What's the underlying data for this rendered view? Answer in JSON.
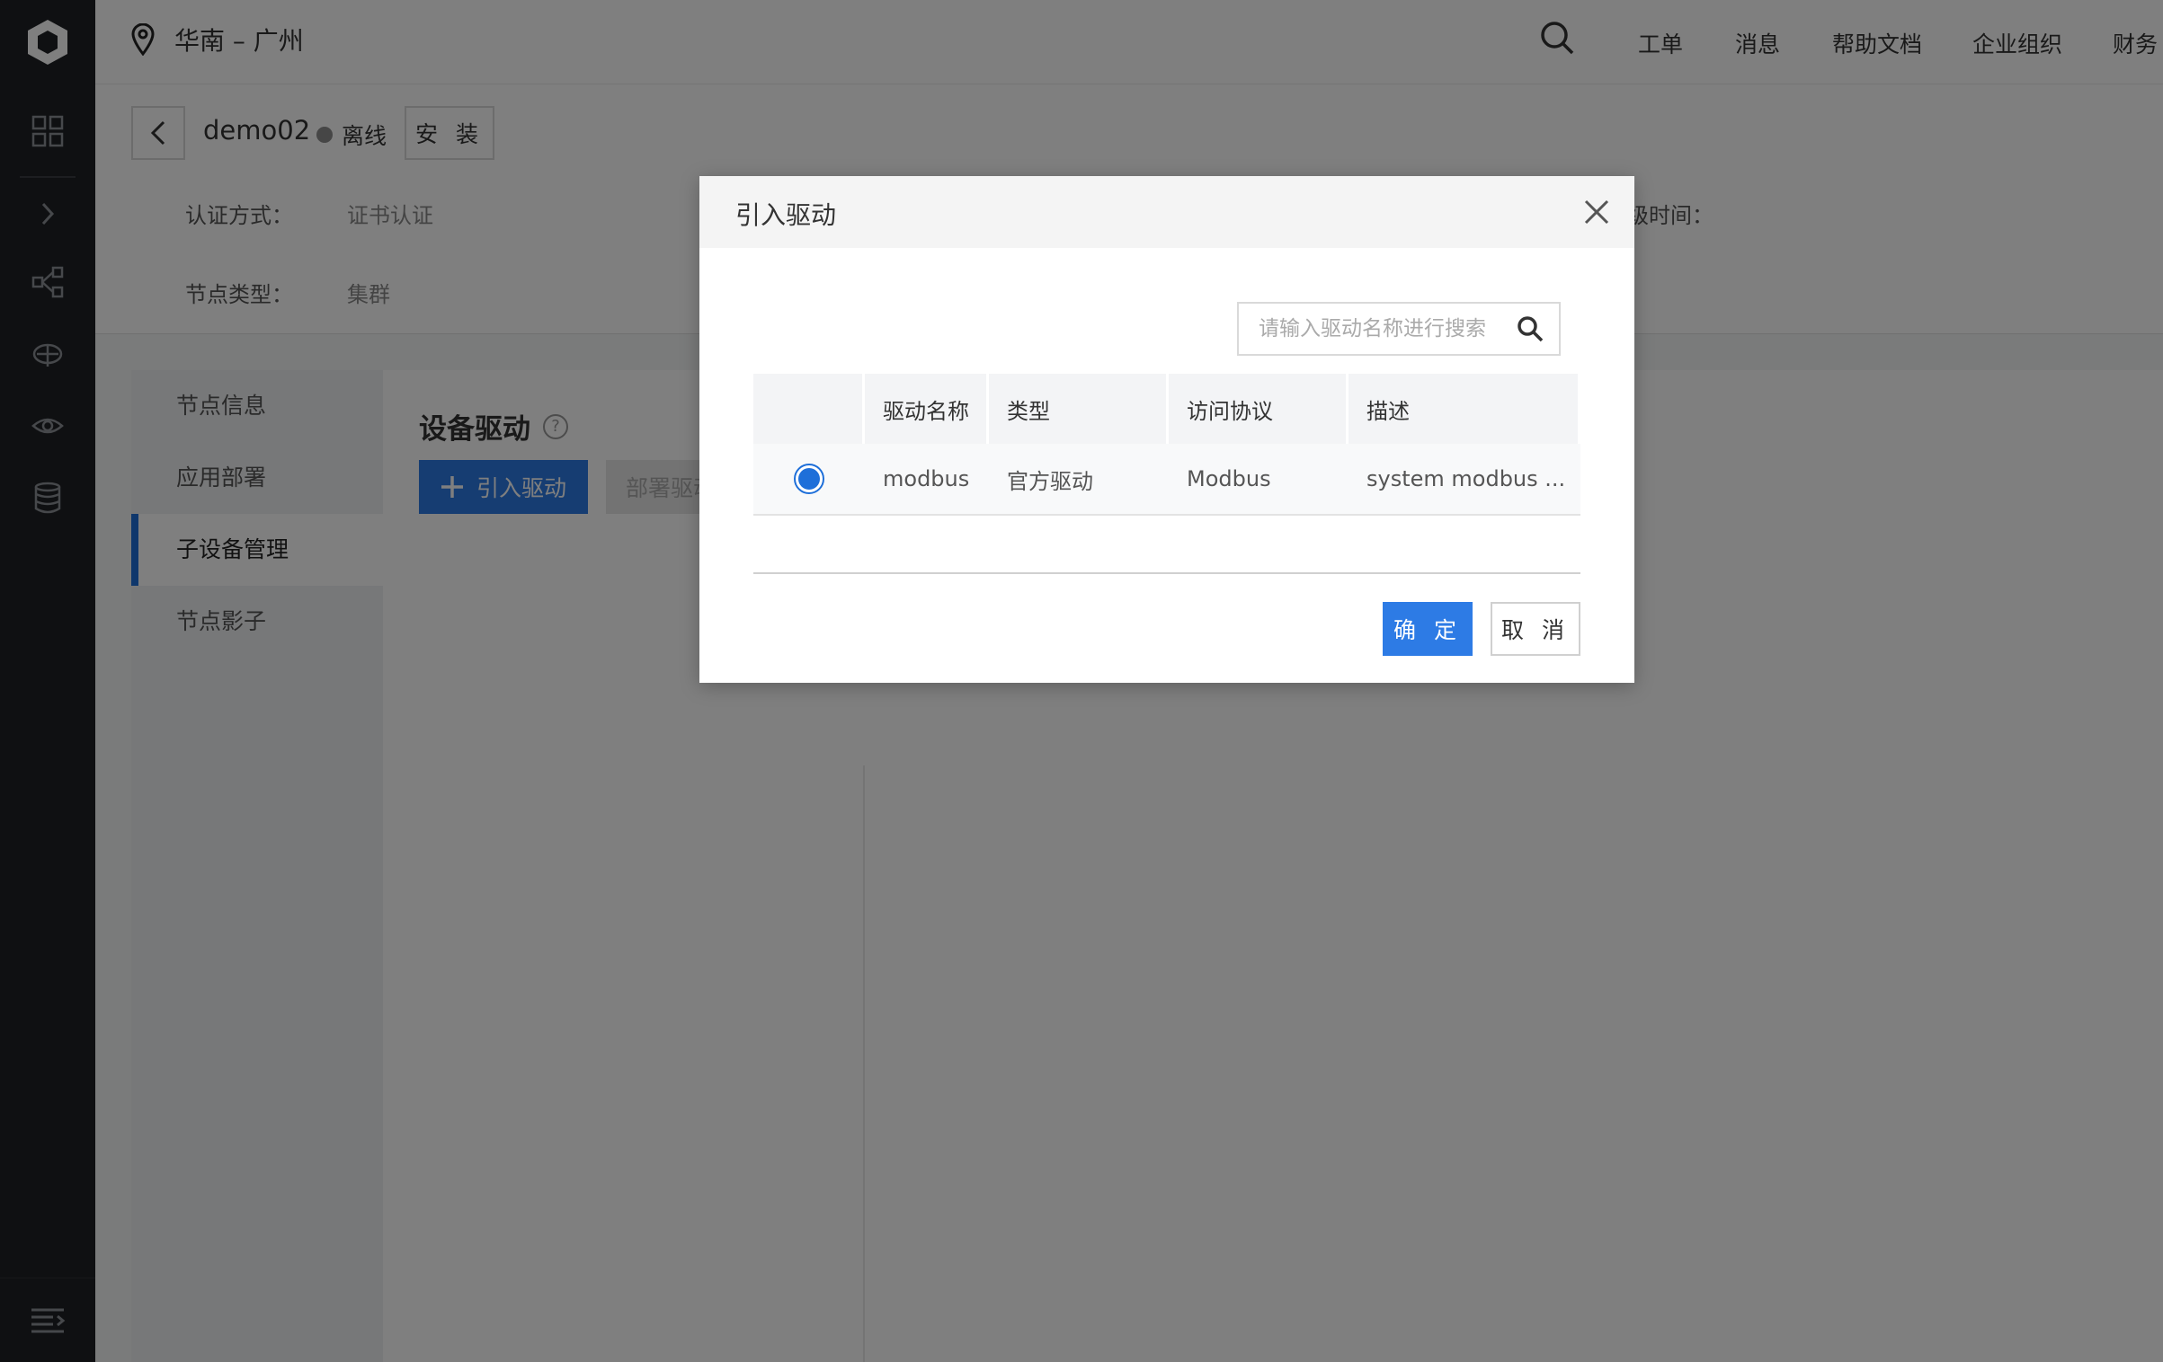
{
  "topbar": {
    "region": "华南 – 广州",
    "nav": [
      "工单",
      "消息",
      "帮助文档",
      "企业组织",
      "财务"
    ]
  },
  "node": {
    "name": "demo02",
    "status": "离线",
    "install_label": "安 装",
    "auth_label": "认证方式：",
    "auth_value": "证书认证",
    "type_label": "节点类型：",
    "type_value": "集群",
    "time_label": "级时间："
  },
  "sub_nav": {
    "items": [
      "节点信息",
      "应用部署",
      "子设备管理",
      "节点影子"
    ],
    "active": "子设备管理"
  },
  "content": {
    "title": "设备驱动",
    "help": "?",
    "import_label": "引入驱动",
    "deploy_label": "部署驱动"
  },
  "modal": {
    "title": "引入驱动",
    "search_placeholder": "请输入驱动名称进行搜索",
    "columns": [
      "",
      "驱动名称",
      "类型",
      "访问协议",
      "描述"
    ],
    "rows": [
      {
        "selected": true,
        "name": "modbus",
        "type": "官方驱动",
        "protocol": "Modbus",
        "desc": "system modbus ..."
      }
    ],
    "ok_label": "确 定",
    "cancel_label": "取 消"
  },
  "colors": {
    "primary": "#2d7be5",
    "sidebar": "#1f2124",
    "overlay": "rgba(0,0,0,0.5)"
  }
}
